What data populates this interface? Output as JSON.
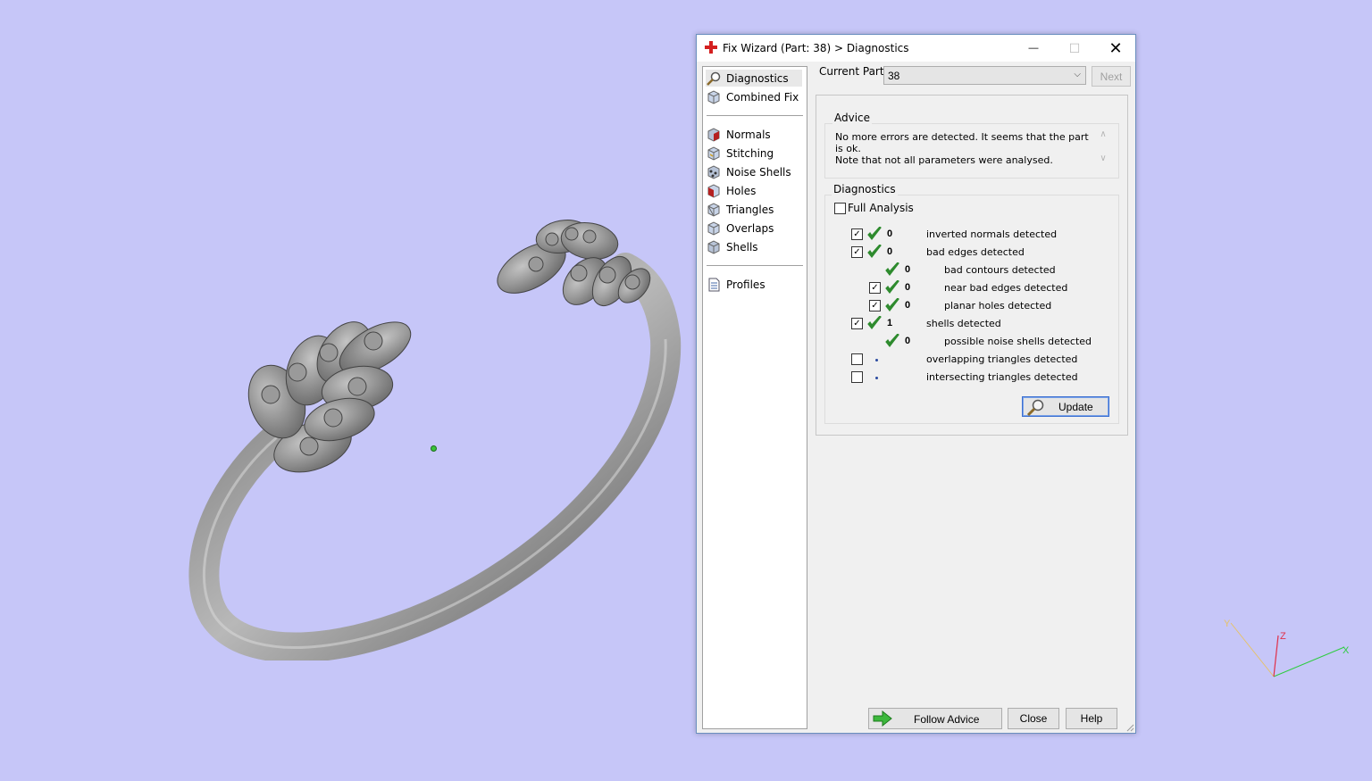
{
  "window": {
    "title": "Fix Wizard (Part: 38) > Diagnostics",
    "minimize_glyph": "—",
    "maximize_glyph": "☐",
    "close_glyph": "✕"
  },
  "sidebar": {
    "items": [
      {
        "label": "Diagnostics",
        "icon": "magnifier-icon",
        "selected": true
      },
      {
        "label": "Combined Fix",
        "icon": "cube-icon"
      },
      {
        "label": "Normals",
        "icon": "normals-cube-icon"
      },
      {
        "label": "Stitching",
        "icon": "stitching-cube-icon"
      },
      {
        "label": "Noise Shells",
        "icon": "noise-shells-icon"
      },
      {
        "label": "Holes",
        "icon": "holes-cube-icon"
      },
      {
        "label": "Triangles",
        "icon": "triangles-cube-icon"
      },
      {
        "label": "Overlaps",
        "icon": "overlaps-cube-icon"
      },
      {
        "label": "Shells",
        "icon": "shells-cube-icon"
      },
      {
        "label": "Profiles",
        "icon": "document-icon"
      }
    ]
  },
  "current_part": {
    "label": "Current Part:",
    "value": "38",
    "next_label": "Next"
  },
  "advice": {
    "legend": "Advice",
    "line1": "No more errors are detected. It seems that the part is ok.",
    "line2": "Note that not all parameters were analysed."
  },
  "diagnostics": {
    "legend": "Diagnostics",
    "full_analysis_label": "Full Analysis",
    "full_analysis_checked": false,
    "rows": [
      {
        "label": "inverted normals detected",
        "count": "0",
        "checked": true,
        "status": "ok"
      },
      {
        "label": "bad edges detected",
        "count": "0",
        "checked": true,
        "status": "ok"
      },
      {
        "label": "bad contours detected",
        "count": "0",
        "status": "ok"
      },
      {
        "label": "near bad edges detected",
        "count": "0",
        "checked": true,
        "status": "ok"
      },
      {
        "label": "planar holes detected",
        "count": "0",
        "checked": true,
        "status": "ok"
      },
      {
        "label": "shells detected",
        "count": "1",
        "checked": true,
        "status": "ok"
      },
      {
        "label": "possible noise shells detected",
        "count": "0",
        "status": "ok"
      },
      {
        "label": "overlapping triangles detected",
        "count": "",
        "checked": false,
        "status": "not-run"
      },
      {
        "label": "intersecting triangles detected",
        "count": "",
        "checked": false,
        "status": "not-run"
      }
    ],
    "update_label": "Update"
  },
  "footer": {
    "follow_label": "Follow Advice",
    "close_label": "Close",
    "help_label": "Help"
  },
  "axes": {
    "x_label": "X",
    "y_label": "Y",
    "z_label": "Z"
  },
  "colors": {
    "viewport_bg": "#c6c6f8",
    "check_green": "#2e8b2e",
    "title_icon_red": "#d42020",
    "update_border": "#3c6fd1"
  }
}
